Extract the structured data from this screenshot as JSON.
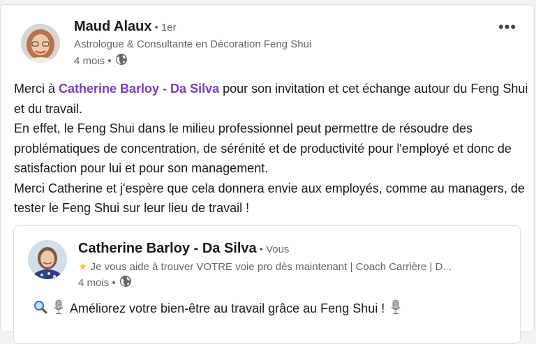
{
  "post": {
    "author": {
      "name": "Maud Alaux",
      "degree": "• 1er",
      "headline": "Astrologue & Consultante en Décoration Feng Shui",
      "time": "4 mois •"
    },
    "menu_label": "•••",
    "body": {
      "p1_before": "Merci à ",
      "p1_mention": "Catherine Barloy - Da Silva",
      "p1_after": " pour son invitation et cet échange autour du Feng Shui et du travail.",
      "p2": "En effet, le Feng Shui dans le milieu professionnel peut permettre de résoudre des problématiques de concentration, de sérénité et de productivité pour l'employé et donc de satisfaction pour lui et pour son management.",
      "p3": "Merci Catherine et j'espère que cela donnera envie aux employés, comme au managers, de tester le Feng Shui sur leur lieu de travail !"
    }
  },
  "quoted_post": {
    "author": {
      "name": "Catherine Barloy - Da Silva",
      "degree": "• Vous",
      "headline": "Je vous aide à trouver VOTRE voie pro dès maintenant | Coach Carrière | D...",
      "time": "4 mois •"
    },
    "text": "Améliorez votre bien-être au travail grâce au Feng Shui !"
  },
  "icons": {
    "globe": "globe-icon",
    "magnifier": "magnifying-glass-icon",
    "microphone": "microphone-icon",
    "star": "star-icon",
    "menu": "more-options-icon"
  },
  "colors": {
    "mention": "#7a3cc2",
    "secondary_text": "#666666",
    "card_border": "#e0dfdc"
  }
}
